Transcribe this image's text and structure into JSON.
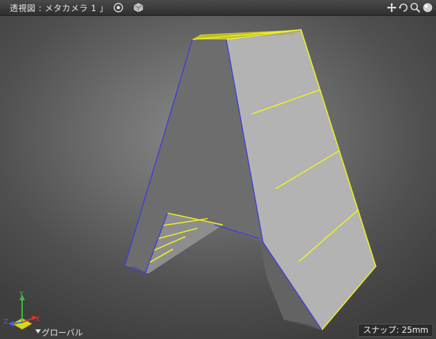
{
  "window": {
    "title": "透視図 : メタカメラ 1 」"
  },
  "toolbar": {
    "left_icons": [
      "target-icon",
      "cube-icon"
    ],
    "right_icons": [
      "pan-icon",
      "rotate-icon",
      "zoom-icon",
      "view-sphere-icon"
    ]
  },
  "axis": {
    "x_label": "X",
    "y_label": "Y",
    "z_label": "Z",
    "coordinate_system": "グローバル"
  },
  "status": {
    "snap": "スナップ: 25mm"
  },
  "colors": {
    "selected_edge": "#f0f020",
    "wire_edge": "#3a3ae0",
    "face_light": "#b4b4b4",
    "face_dark": "#6a6a6a",
    "x_axis": "#e03030",
    "y_axis": "#40c040",
    "z_axis": "#4060f0"
  }
}
